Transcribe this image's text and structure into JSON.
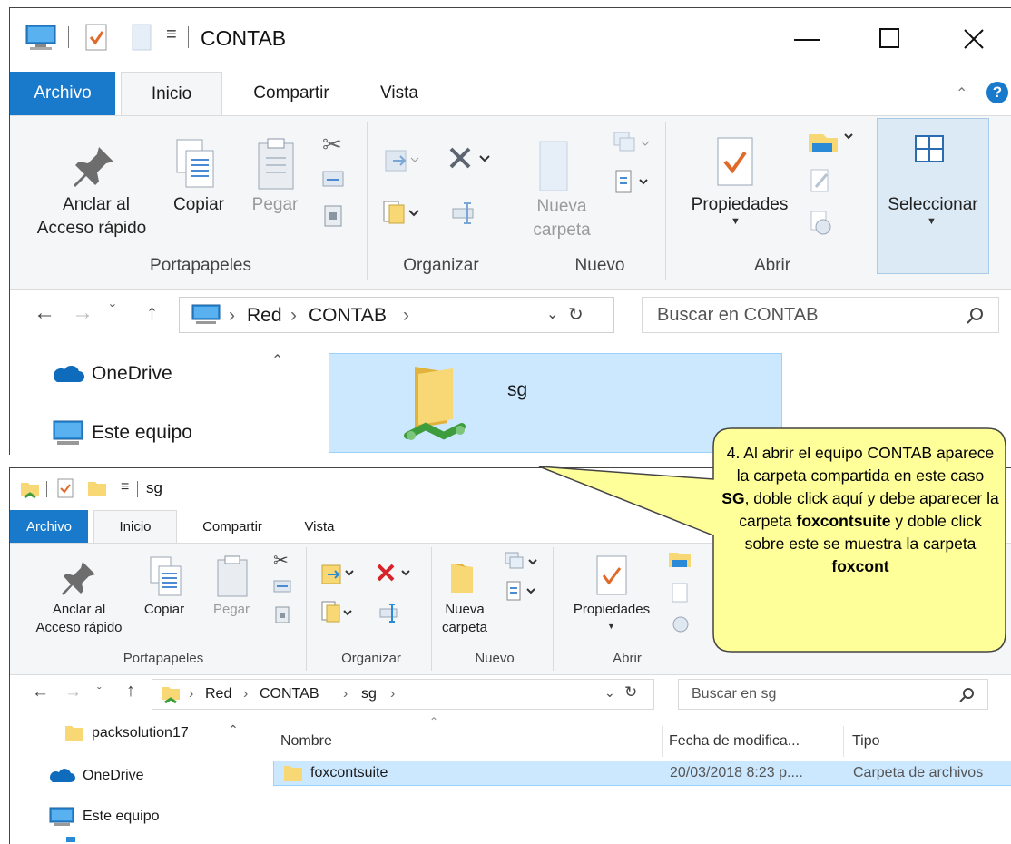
{
  "window1": {
    "title": "CONTAB",
    "tabs": {
      "archivo": "Archivo",
      "inicio": "Inicio",
      "compartir": "Compartir",
      "vista": "Vista"
    },
    "ribbon": {
      "anclar_line1": "Anclar al",
      "anclar_line2": "Acceso rápido",
      "copiar": "Copiar",
      "pegar": "Pegar",
      "nueva_line1": "Nueva",
      "nueva_line2": "carpeta",
      "propiedades": "Propiedades",
      "seleccionar": "Seleccionar",
      "groups": {
        "portapapeles": "Portapapeles",
        "organizar": "Organizar",
        "nuevo": "Nuevo",
        "abrir": "Abrir"
      }
    },
    "address": {
      "crumbs": [
        "Red",
        "CONTAB"
      ],
      "search_placeholder": "Buscar en CONTAB"
    },
    "sidebar": [
      "OneDrive",
      "Este equipo"
    ],
    "content": {
      "folder_name": "sg"
    }
  },
  "window2": {
    "title": "sg",
    "tabs": {
      "archivo": "Archivo",
      "inicio": "Inicio",
      "compartir": "Compartir",
      "vista": "Vista"
    },
    "ribbon": {
      "anclar_line1": "Anclar al",
      "anclar_line2": "Acceso rápido",
      "copiar": "Copiar",
      "pegar": "Pegar",
      "nueva_line1": "Nueva",
      "nueva_line2": "carpeta",
      "propiedades": "Propiedades",
      "groups": {
        "portapapeles": "Portapapeles",
        "organizar": "Organizar",
        "nuevo": "Nuevo",
        "abrir": "Abrir"
      }
    },
    "address": {
      "crumbs": [
        "Red",
        "CONTAB",
        "sg"
      ],
      "search_placeholder": "Buscar en sg"
    },
    "sidebar": [
      "packsolution17",
      "OneDrive",
      "Este equipo"
    ],
    "columns": {
      "name": "Nombre",
      "date": "Fecha de modifica...",
      "type": "Tipo"
    },
    "rows": [
      {
        "name": "foxcontsuite",
        "date": "20/03/2018 8:23 p....",
        "type": "Carpeta de archivos"
      }
    ]
  },
  "callout": {
    "p1": "4. Al abrir el equipo CONTAB aparece la carpeta compartida en este caso ",
    "b1": "SG",
    "p2": ", doble click aquí y debe aparecer la carpeta ",
    "b2": "foxcontsuite",
    "p3": " y doble click sobre este se muestra la carpeta ",
    "b3": "foxcont"
  },
  "colors": {
    "accent": "#1979ca",
    "selection": "#cce8ff",
    "selection_border": "#99d1ff",
    "callout_fill": "#ffff99",
    "folder": "#f8d775"
  }
}
